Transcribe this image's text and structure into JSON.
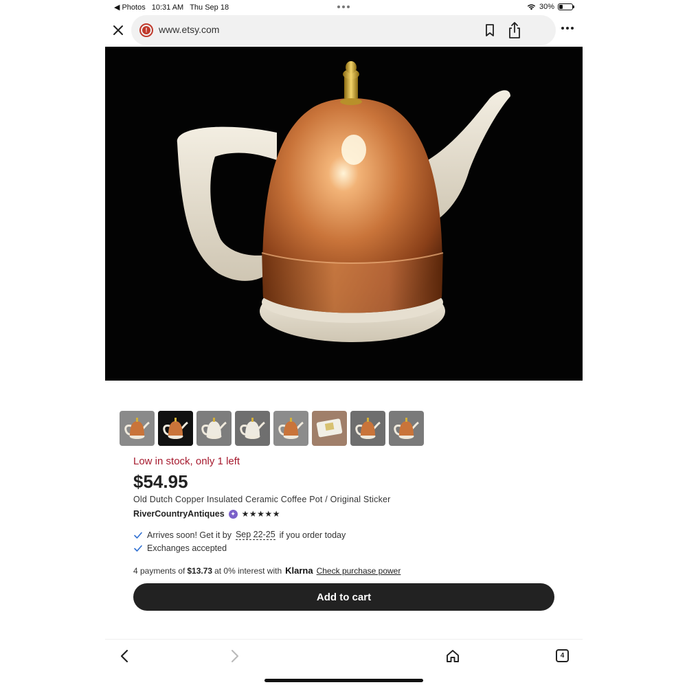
{
  "status_bar": {
    "back_app": "Photos",
    "time": "10:31 AM",
    "date": "Thu Sep 18",
    "battery": "30%",
    "battery_level": 0.3
  },
  "browser": {
    "url": "www.etsy.com",
    "icons": [
      "close-icon",
      "site-warning-icon",
      "bookmark-icon",
      "share-icon",
      "more-icon"
    ]
  },
  "thumbnails": [
    {
      "name": "thumb-1",
      "selected": false
    },
    {
      "name": "thumb-2",
      "selected": true
    },
    {
      "name": "thumb-3",
      "selected": false
    },
    {
      "name": "thumb-4",
      "selected": false
    },
    {
      "name": "thumb-5",
      "selected": false
    },
    {
      "name": "thumb-6",
      "selected": false
    },
    {
      "name": "thumb-7",
      "selected": false
    },
    {
      "name": "thumb-8",
      "selected": false
    }
  ],
  "product": {
    "stock": "Low in stock, only 1 left",
    "price": "$54.95",
    "title": "Old Dutch Copper Insulated Ceramic Coffee Pot / Original Sticker",
    "seller": "RiverCountryAntiques",
    "rating_stars": "★★★★★",
    "rating": 5
  },
  "perks": {
    "arrives_prefix": "Arrives soon! Get it by",
    "arrives_date": "Sep 22-25",
    "arrives_suffix": "if you order today",
    "exchanges": "Exchanges accepted"
  },
  "klarna": {
    "prefix": "4 payments of",
    "amount": "$13.73",
    "middle": "at 0% interest with",
    "brand": "Klarna",
    "link": "Check purchase power"
  },
  "cart_button": "Add to cart",
  "bottom_nav": {
    "tab_count": "4"
  },
  "colors": {
    "stock_red": "#a61a2e",
    "button_dark": "#222222",
    "check_blue": "#2f6fd1",
    "star_seller_purple": "#7b61c9",
    "copper": "#c9743a"
  }
}
